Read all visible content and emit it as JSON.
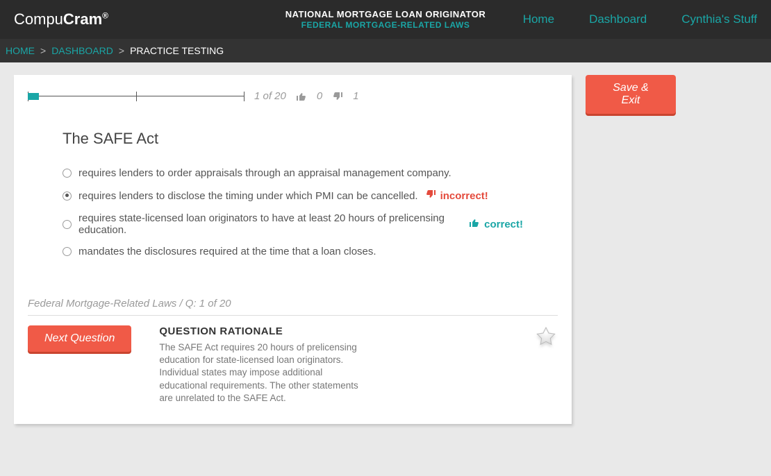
{
  "brand": {
    "thin": "Compu",
    "bold": "Cram",
    "reg": "®"
  },
  "program": {
    "line1": "NATIONAL MORTGAGE LOAN ORIGINATOR",
    "line2": "FEDERAL MORTGAGE-RELATED LAWS"
  },
  "nav": {
    "home": "Home",
    "dashboard": "Dashboard",
    "user": "Cynthia's Stuff"
  },
  "crumbs": {
    "a": "HOME",
    "b": "DASHBOARD",
    "c": "PRACTICE TESTING",
    "sep": ">"
  },
  "progress": {
    "counter": "1 of 20",
    "up": "0",
    "down": "1",
    "fill_pct": 5,
    "mid_pct": 50
  },
  "question": {
    "title": "The SAFE Act",
    "answers": [
      {
        "text": "requires lenders to order appraisals through an appraisal management company.",
        "selected": false,
        "result": null
      },
      {
        "text": "requires lenders to disclose the timing under which PMI can be cancelled.",
        "selected": true,
        "result": "incorrect"
      },
      {
        "text": "requires state-licensed loan originators to have at least 20 hours of prelicensing education.",
        "selected": false,
        "result": "correct"
      },
      {
        "text": "mandates the disclosures required at the time that a loan closes.",
        "selected": false,
        "result": null
      }
    ],
    "tags": {
      "incorrect": "incorrect!",
      "correct": "correct!"
    },
    "subline": "Federal Mortgage-Related Laws / Q: 1 of 20"
  },
  "rationale": {
    "heading": "QUESTION RATIONALE",
    "body": "The SAFE Act requires 20 hours of prelicensing education for state-licensed loan originators. Individual states may impose additional educational requirements. The other statements are unrelated to the SAFE Act."
  },
  "buttons": {
    "next": "Next Question",
    "save_exit": "Save & Exit"
  },
  "colors": {
    "accent": "#1aa6a6",
    "danger": "#e44a3c",
    "primary_btn": "#f05a47"
  }
}
